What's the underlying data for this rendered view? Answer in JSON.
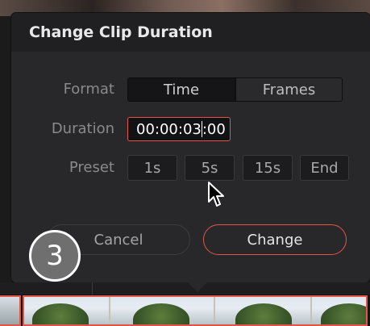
{
  "dialog": {
    "title": "Change Clip Duration",
    "format_label": "Format",
    "format_options": [
      "Time",
      "Frames"
    ],
    "format_selected": "Time",
    "duration_label": "Duration",
    "duration_value_before_caret": "00:00:03",
    "duration_value_after_caret": ":00",
    "preset_label": "Preset",
    "presets": [
      "1s",
      "5s",
      "15s",
      "End"
    ],
    "cancel_label": "Cancel",
    "change_label": "Change"
  },
  "overlay": {
    "step_number": "3"
  },
  "colors": {
    "accent": "#e0574a",
    "dialog_bg": "#28282b",
    "header_bg": "#202022"
  }
}
